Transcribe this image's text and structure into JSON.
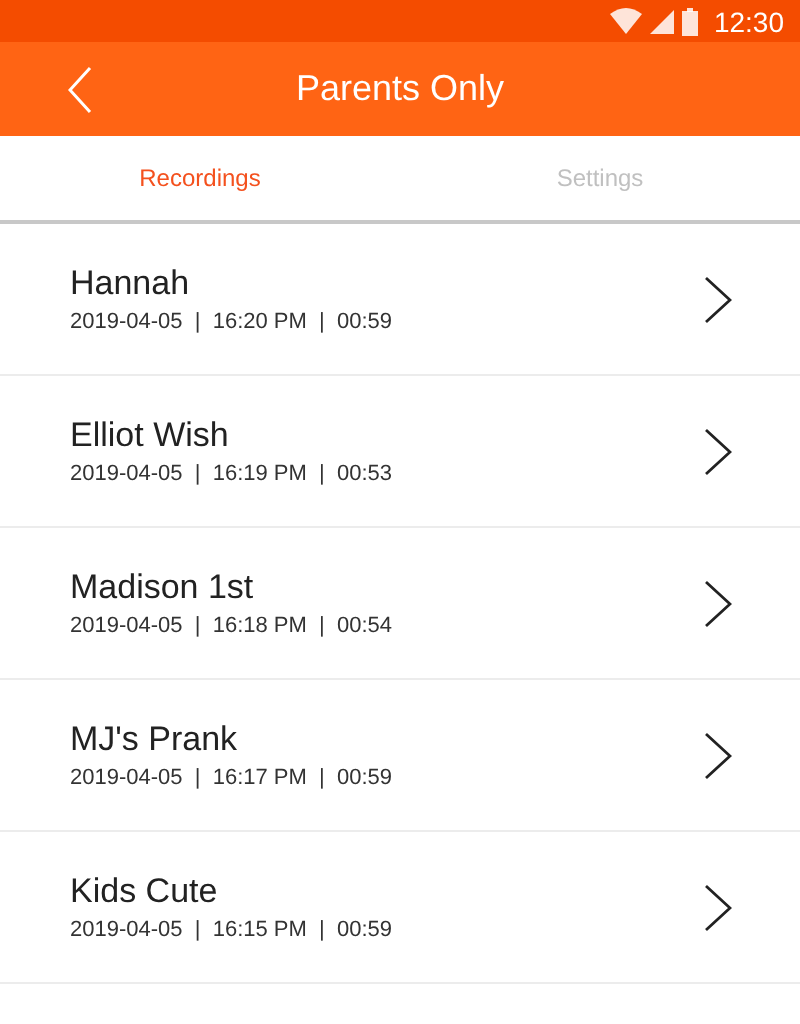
{
  "status_bar": {
    "time": "12:30"
  },
  "app_bar": {
    "title": "Parents Only"
  },
  "tabs": [
    {
      "label": "Recordings",
      "selected": true
    },
    {
      "label": "Settings",
      "selected": false
    }
  ],
  "recordings": [
    {
      "name": "Hannah",
      "details": "2019-04-05  |  16:20 PM  |  00:59"
    },
    {
      "name": "Elliot Wish",
      "details": "2019-04-05  |  16:19 PM  |  00:53"
    },
    {
      "name": "Madison 1st",
      "details": "2019-04-05  |  16:18 PM  |  00:54"
    },
    {
      "name": "MJ's Prank",
      "details": "2019-04-05  |  16:17 PM  |  00:59"
    },
    {
      "name": "Kids Cute",
      "details": "2019-04-05  |  16:15 PM  |  00:59"
    }
  ]
}
